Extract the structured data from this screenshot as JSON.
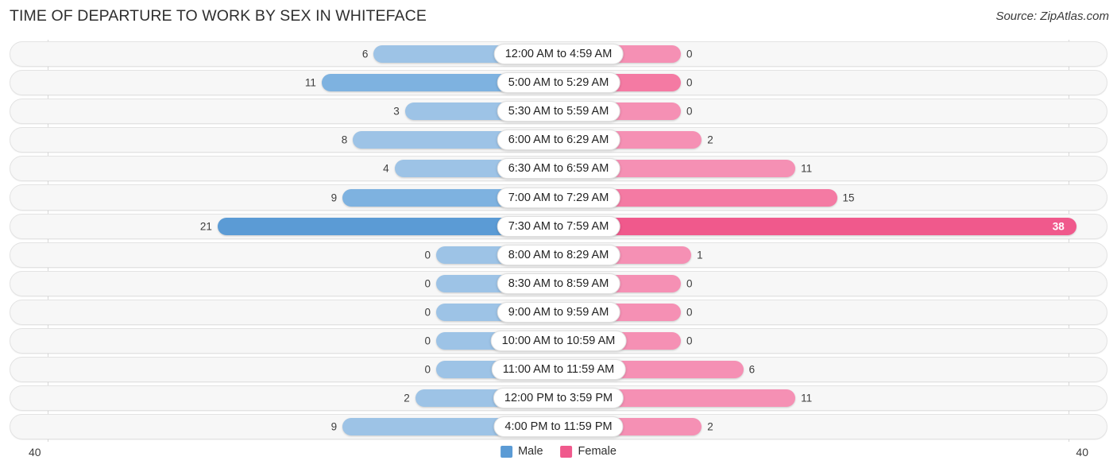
{
  "header": {
    "title": "TIME OF DEPARTURE TO WORK BY SEX IN WHITEFACE",
    "source": "Source: ZipAtlas.com"
  },
  "legend": {
    "items": [
      {
        "label": "Male",
        "color": "#5b9bd5"
      },
      {
        "label": "Female",
        "color": "#f0598c"
      }
    ]
  },
  "axis": {
    "left_tick": "40",
    "right_tick": "40"
  },
  "chart_data": {
    "type": "bar",
    "title": "TIME OF DEPARTURE TO WORK BY SEX IN WHITEFACE",
    "orientation": "horizontal-diverging",
    "xlabel": "",
    "ylabel": "",
    "xlim": [
      40,
      40
    ],
    "grid": false,
    "legend_position": "bottom-center",
    "categories": [
      "12:00 AM to 4:59 AM",
      "5:00 AM to 5:29 AM",
      "5:30 AM to 5:59 AM",
      "6:00 AM to 6:29 AM",
      "6:30 AM to 6:59 AM",
      "7:00 AM to 7:29 AM",
      "7:30 AM to 7:59 AM",
      "8:00 AM to 8:29 AM",
      "8:30 AM to 8:59 AM",
      "9:00 AM to 9:59 AM",
      "10:00 AM to 10:59 AM",
      "11:00 AM to 11:59 AM",
      "12:00 PM to 3:59 PM",
      "4:00 PM to 11:59 PM"
    ],
    "series": [
      {
        "name": "Male",
        "color": "#5b9bd5",
        "values": [
          6,
          11,
          3,
          8,
          4,
          9,
          21,
          0,
          0,
          0,
          0,
          0,
          2,
          9
        ]
      },
      {
        "name": "Female",
        "color": "#f0598c",
        "values": [
          0,
          0,
          0,
          2,
          11,
          15,
          38,
          1,
          0,
          0,
          0,
          6,
          11,
          2
        ]
      }
    ]
  },
  "rows": [
    {
      "category": "12:00 AM to 4:59 AM",
      "male": "6",
      "female": "0",
      "emphasis": "none"
    },
    {
      "category": "5:00 AM to 5:29 AM",
      "male": "11",
      "female": "0",
      "emphasis": "strong"
    },
    {
      "category": "5:30 AM to 5:59 AM",
      "male": "3",
      "female": "0",
      "emphasis": "none"
    },
    {
      "category": "6:00 AM to 6:29 AM",
      "male": "8",
      "female": "2",
      "emphasis": "none"
    },
    {
      "category": "6:30 AM to 6:59 AM",
      "male": "4",
      "female": "11",
      "emphasis": "none"
    },
    {
      "category": "7:00 AM to 7:29 AM",
      "male": "9",
      "female": "15",
      "emphasis": "strong"
    },
    {
      "category": "7:30 AM to 7:59 AM",
      "male": "21",
      "female": "38",
      "emphasis": "accent"
    },
    {
      "category": "8:00 AM to 8:29 AM",
      "male": "0",
      "female": "1",
      "emphasis": "none"
    },
    {
      "category": "8:30 AM to 8:59 AM",
      "male": "0",
      "female": "0",
      "emphasis": "none"
    },
    {
      "category": "9:00 AM to 9:59 AM",
      "male": "0",
      "female": "0",
      "emphasis": "none"
    },
    {
      "category": "10:00 AM to 10:59 AM",
      "male": "0",
      "female": "0",
      "emphasis": "none"
    },
    {
      "category": "11:00 AM to 11:59 AM",
      "male": "0",
      "female": "6",
      "emphasis": "none"
    },
    {
      "category": "12:00 PM to 3:59 PM",
      "male": "2",
      "female": "11",
      "emphasis": "none"
    },
    {
      "category": "4:00 PM to 11:59 PM",
      "male": "9",
      "female": "2",
      "emphasis": "none"
    }
  ]
}
